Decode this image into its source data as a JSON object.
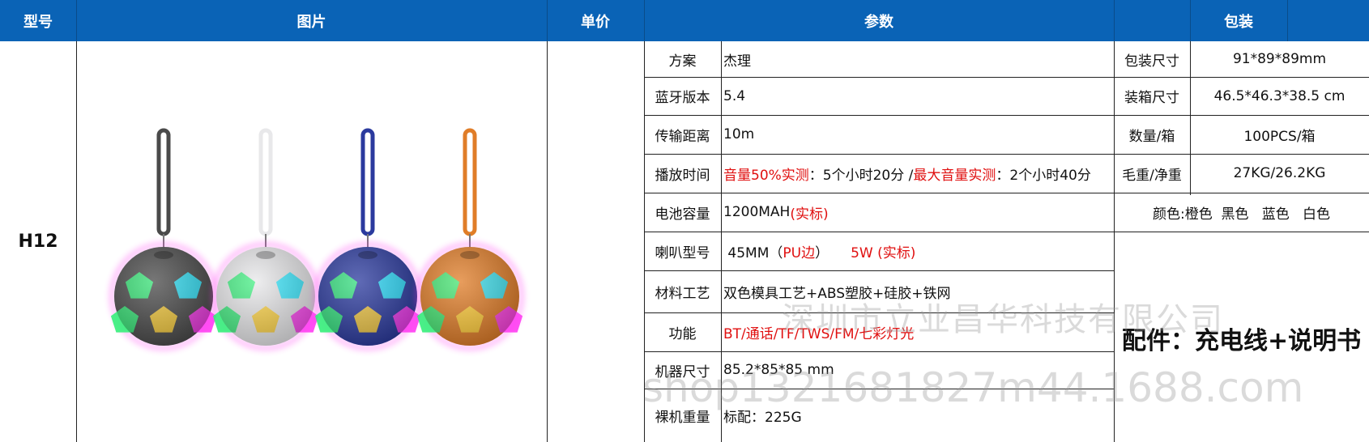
{
  "header": {
    "model": "型号",
    "image": "图片",
    "price": "单价",
    "params": "参数",
    "packing": "包装"
  },
  "product": {
    "model": "H12",
    "ball_colors": [
      "#4a4a4a",
      "#e8e8ea",
      "#2b3a9e",
      "#e07d28"
    ]
  },
  "params": [
    {
      "label": "方案",
      "value": "杰理"
    },
    {
      "label": "蓝牙版本",
      "value": "5.4"
    },
    {
      "label": "传输距离",
      "value": "10m"
    },
    {
      "label": "播放时间",
      "v1": "音量50%实测",
      "v2": "：5个小时20分 / ",
      "v3": "最大音量实测",
      "v4": "：2个小时40分"
    },
    {
      "label": "电池容量",
      "v1": "1200MAH ",
      "v2": "(实标)"
    },
    {
      "label": "喇叭型号",
      "v1": " 45MM（",
      "v2": "PU边",
      "v3": "）     ",
      "v4": "5W (实标)"
    },
    {
      "label": "材料工艺",
      "value": "双色模具工艺+ABS塑胶+硅胶+铁网"
    },
    {
      "label": "功能",
      "value": "BT/通话/TF/TWS/FM/七彩灯光"
    },
    {
      "label": "机器尺寸",
      "value": "85.2*85*85 mm"
    },
    {
      "label": "裸机重量",
      "value": "标配：225G"
    }
  ],
  "packing": [
    {
      "label": "包装尺寸",
      "value": "91*89*89mm"
    },
    {
      "label": "装箱尺寸",
      "value": "46.5*46.3*38.5 cm"
    },
    {
      "label": "数量/箱",
      "value": "100PCS/箱"
    },
    {
      "label": "毛重/净重",
      "value": "27KG/26.2KG"
    }
  ],
  "colors_line": "颜色:橙色  黑色   蓝色   白色",
  "accessory": "配件：充电线+说明书",
  "watermark": {
    "company": "深圳市立业昌华科技有限公司",
    "shop": "shop1321681827m44.1688.com"
  }
}
